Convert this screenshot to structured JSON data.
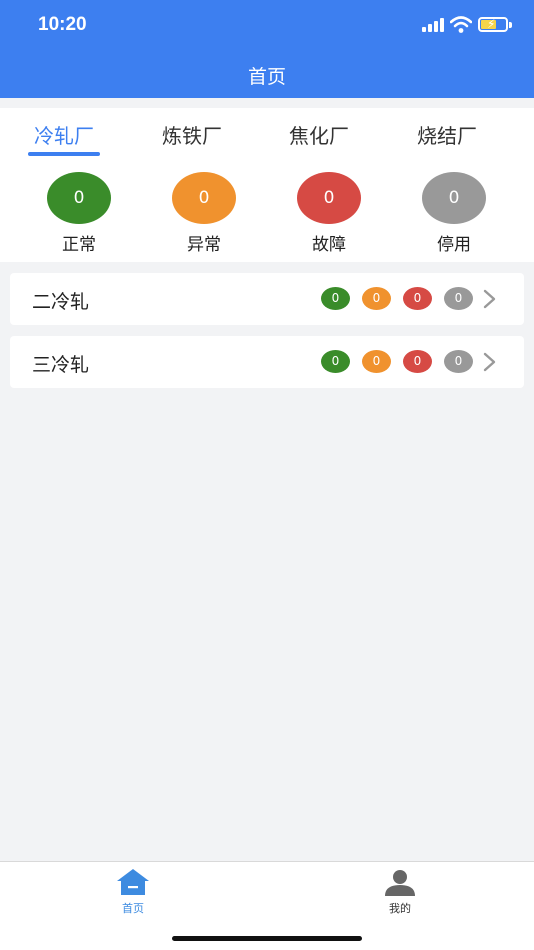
{
  "status_bar": {
    "time": "10:20"
  },
  "header": {
    "title": "首页"
  },
  "plant_tabs": [
    {
      "label": "冷轧厂",
      "active": true
    },
    {
      "label": "炼铁厂",
      "active": false
    },
    {
      "label": "焦化厂",
      "active": false
    },
    {
      "label": "烧结厂",
      "active": false
    }
  ],
  "summary": [
    {
      "count": "0",
      "label": "正常",
      "color": "#3a8c2a"
    },
    {
      "count": "0",
      "label": "异常",
      "color": "#f0922e"
    },
    {
      "count": "0",
      "label": "故障",
      "color": "#d64a44"
    },
    {
      "count": "0",
      "label": "停用",
      "color": "#999999"
    }
  ],
  "lines": [
    {
      "name": "二冷轧",
      "counts": [
        "0",
        "0",
        "0",
        "0"
      ]
    },
    {
      "name": "三冷轧",
      "counts": [
        "0",
        "0",
        "0",
        "0"
      ]
    }
  ],
  "bottom_tabs": [
    {
      "label": "首页",
      "icon": "home-icon",
      "active": true,
      "color": "#3d8be0"
    },
    {
      "label": "我的",
      "icon": "person-icon",
      "active": false,
      "color": "#333333"
    }
  ]
}
